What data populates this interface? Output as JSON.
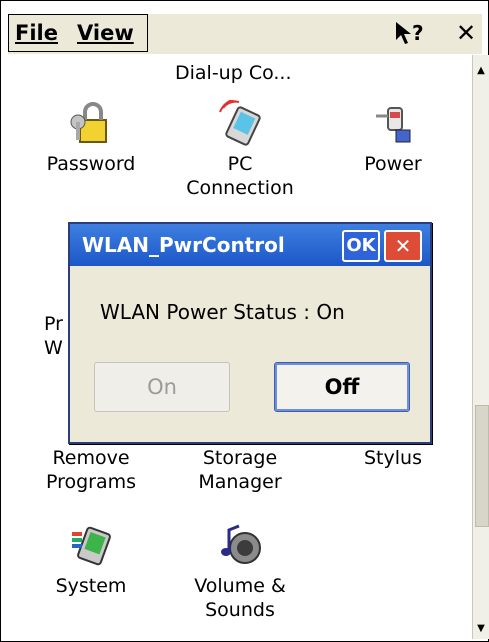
{
  "menubar": {
    "file": "File",
    "view": "View",
    "help": "?",
    "close": "✕"
  },
  "top_item": {
    "label": "Dial-up Co..."
  },
  "icons": [
    {
      "label": "Password"
    },
    {
      "label_line1": "PC",
      "label_line2": "Connection"
    },
    {
      "label": "Power"
    },
    {
      "label_line1": "Pr",
      "label_line2": "W"
    },
    {
      "label_line1": "Remove",
      "label_line2": "Programs"
    },
    {
      "label_line1": "Storage",
      "label_line2": "Manager"
    },
    {
      "label": "Stylus"
    },
    {
      "label": "System"
    },
    {
      "label_line1": "Volume &",
      "label_line2": "Sounds"
    }
  ],
  "dialog": {
    "title": "WLAN_PwrControl",
    "ok": "OK",
    "close": "✕",
    "status_text": "WLAN Power Status : On",
    "on_button": "On",
    "off_button": "Off"
  }
}
